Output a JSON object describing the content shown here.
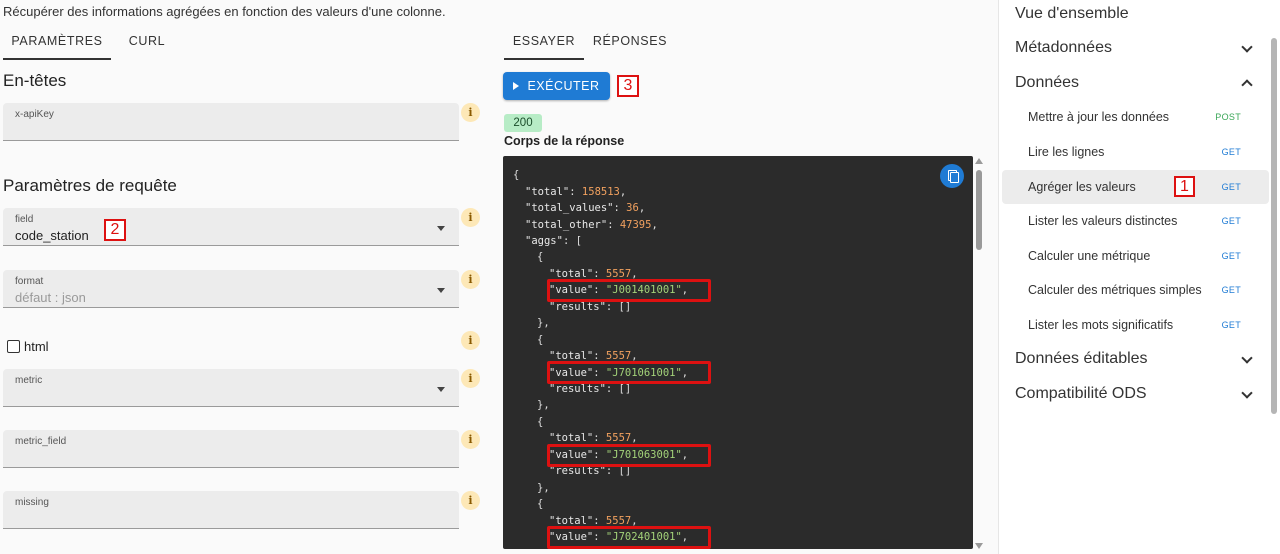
{
  "description": "Récupérer des informations agrégées en fonction des valeurs d'une colonne.",
  "left_tabs": [
    "PARAMÈTRES",
    "CURL"
  ],
  "headers_title": "En-têtes",
  "query_title": "Paramètres de requête",
  "fields": {
    "apikey": {
      "label": "x-apiKey",
      "value": ""
    },
    "field": {
      "label": "field",
      "value": "code_station"
    },
    "format": {
      "label": "format",
      "placeholder": "défaut : json"
    },
    "metric": {
      "label": "metric",
      "value": ""
    },
    "metric_field": {
      "label": "metric_field",
      "value": ""
    },
    "missing": {
      "label": "missing",
      "value": ""
    }
  },
  "html_checkbox": {
    "label": "html",
    "checked": false
  },
  "info_glyph": "i",
  "annotations": {
    "one": "1",
    "two": "2",
    "three": "3"
  },
  "mid_tabs": [
    "ESSAYER",
    "RÉPONSES"
  ],
  "run_button": "EXÉCUTER",
  "status_code": "200",
  "response_title": "Corps de la réponse",
  "response": {
    "total": "158513",
    "total_values": "36",
    "total_other": "47395",
    "aggs": [
      {
        "total": "5557",
        "value": "\"J001401001\""
      },
      {
        "total": "5557",
        "value": "\"J701061001\""
      },
      {
        "total": "5557",
        "value": "\"J701063001\""
      },
      {
        "total": "5557",
        "value": "\"J702401001\""
      }
    ]
  },
  "nav": {
    "overview": "Vue d'ensemble",
    "metadata": "Métadonnées",
    "data": "Données",
    "items": [
      {
        "label": "Mettre à jour les données",
        "method": "POST"
      },
      {
        "label": "Lire les lignes",
        "method": "GET"
      },
      {
        "label": "Agréger les valeurs",
        "method": "GET"
      },
      {
        "label": "Lister les valeurs distinctes",
        "method": "GET"
      },
      {
        "label": "Calculer une métrique",
        "method": "GET"
      },
      {
        "label": "Calculer des métriques simples",
        "method": "GET"
      },
      {
        "label": "Lister les mots significatifs",
        "method": "GET"
      }
    ],
    "editable": "Données éditables",
    "ods": "Compatibilité ODS"
  },
  "colors": {
    "accent": "#1f7bd4",
    "post": "#3aa757",
    "get": "#1f7bd4",
    "annotation": "#dd1111"
  }
}
